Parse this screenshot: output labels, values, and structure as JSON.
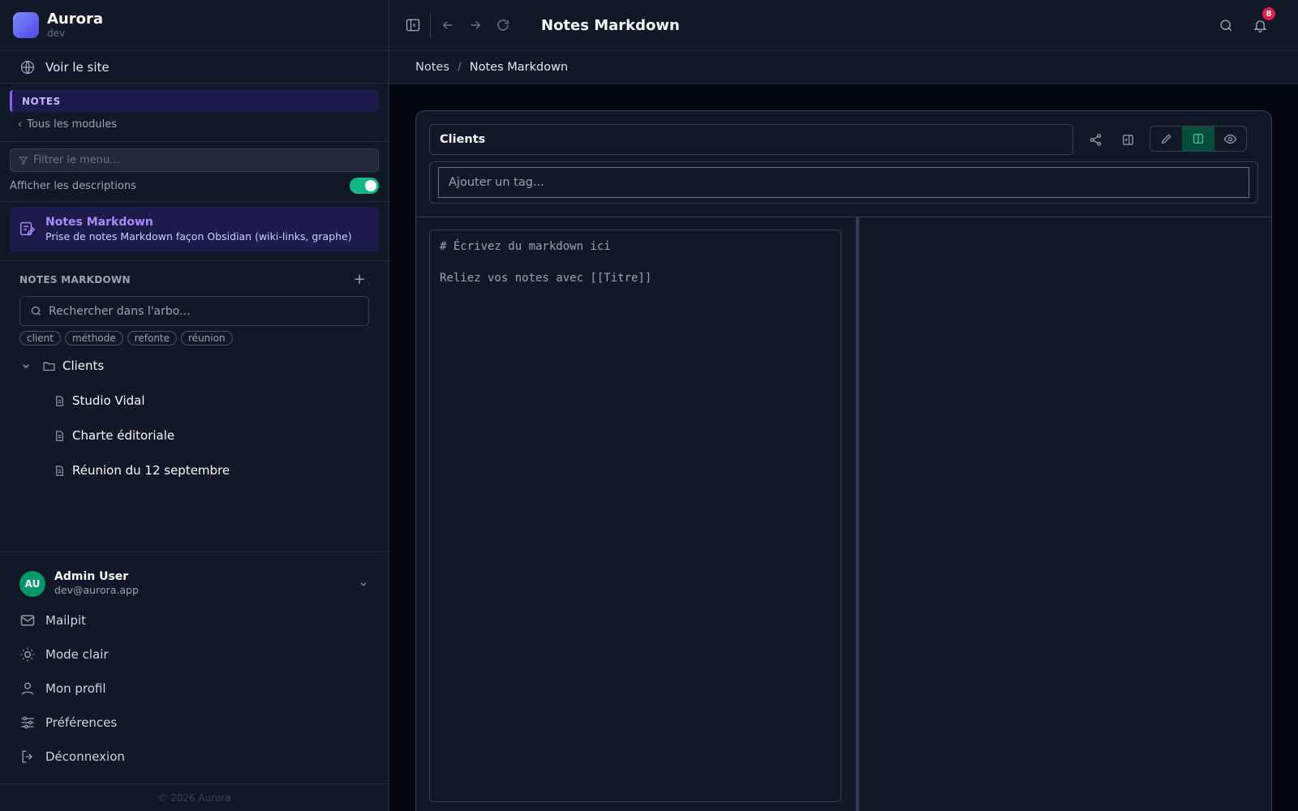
{
  "brand": {
    "name": "Aurora",
    "env": "dev"
  },
  "sidebar": {
    "view_site": "Voir le site",
    "module_header": "NOTES",
    "back_link": "Tous les modules",
    "filter_placeholder": "Filtrer le menu...",
    "show_descriptions_label": "Afficher les descriptions",
    "show_descriptions_on": true,
    "active_module": {
      "title": "Notes Markdown",
      "description": "Prise de notes Markdown façon Obsidian (wiki-links, graphe)"
    },
    "tree": {
      "heading": "NOTES MARKDOWN",
      "add_label": "+",
      "search_placeholder": "Rechercher dans l'arbo...",
      "tags": [
        "client",
        "méthode",
        "refonte",
        "réunion"
      ],
      "folder": "Clients",
      "notes": [
        "Studio Vidal",
        "Charte éditoriale",
        "Réunion du 12 septembre"
      ]
    }
  },
  "user": {
    "initials": "AU",
    "name": "Admin User",
    "email": "dev@aurora.app"
  },
  "menu": [
    "Mailpit",
    "Mode clair",
    "Mon profil",
    "Préférences",
    "Déconnexion"
  ],
  "footer": "© 2026 Aurora",
  "topbar": {
    "title": "Notes Markdown",
    "notification_count": "8"
  },
  "breadcrumb": {
    "parent": "Notes",
    "separator": "/",
    "current": "Notes Markdown"
  },
  "editor": {
    "title_value": "Clients",
    "tag_placeholder": "Ajouter un tag...",
    "placeholder_line1": "# Écrivez du markdown ici",
    "placeholder_line2": "Reliez vos notes avec [[Titre]]",
    "view_mode": "split"
  },
  "colors": {
    "accent": "#8b5cf6",
    "toggle": "#10b981",
    "badge": "#e11d48",
    "avatar": "#059669"
  }
}
